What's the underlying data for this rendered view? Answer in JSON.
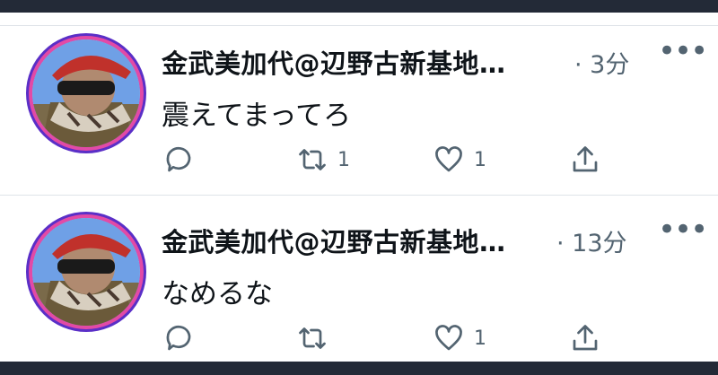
{
  "tweets": [
    {
      "author": "金武美加代@辺野古新基地…",
      "time": "· 3分",
      "text": "震えてまってろ",
      "actions": {
        "reply": "",
        "retweet": "1",
        "like": "1"
      }
    },
    {
      "author": "金武美加代@辺野古新基地…",
      "time": "· 13分",
      "text": "なめるな",
      "actions": {
        "reply": "",
        "retweet": "",
        "like": "1"
      }
    }
  ],
  "icons": {
    "more": "more-icon",
    "reply": "reply-icon",
    "retweet": "retweet-icon",
    "like": "like-icon",
    "share": "share-icon"
  },
  "colors": {
    "text": "#0f1419",
    "muted": "#536471",
    "frame": "#232a37",
    "divider": "#dfe3e8"
  }
}
